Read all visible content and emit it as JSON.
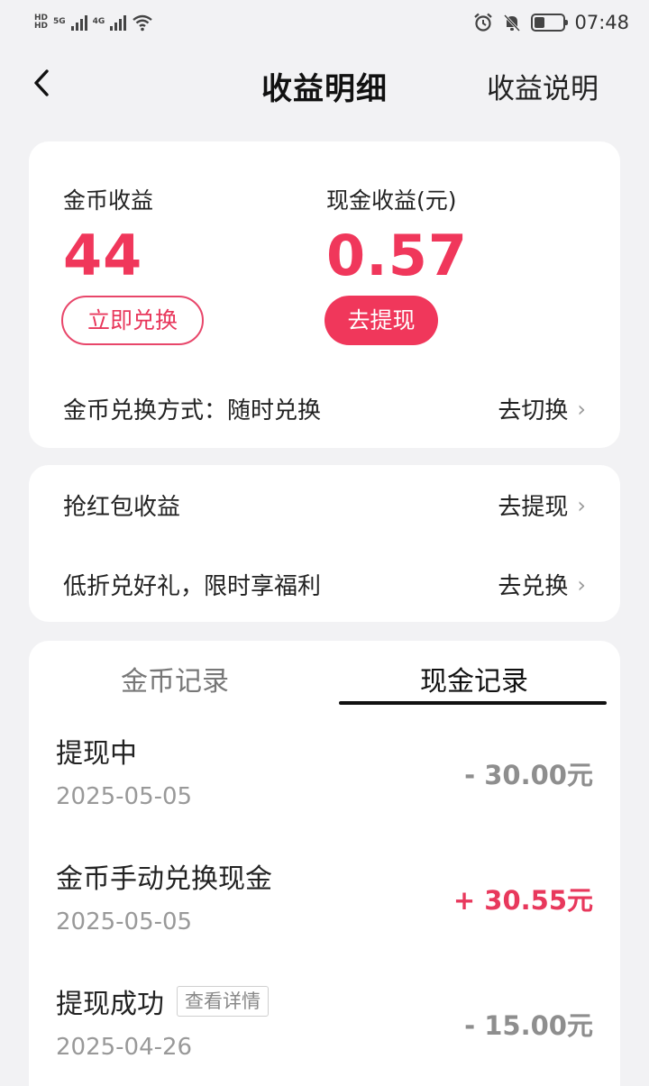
{
  "status_bar": {
    "sim1": "5G",
    "sim2": "4G",
    "time": "07:48"
  },
  "nav": {
    "title": "收益明细",
    "right_link": "收益说明"
  },
  "earnings": {
    "coin_label": "金币收益",
    "coin_value": "44",
    "cash_label": "现金收益(元)",
    "cash_value": "0.57",
    "exchange_button": "立即兑换",
    "withdraw_button": "去提现",
    "method_label": "金币兑换方式：随时兑换",
    "method_action": "去切换"
  },
  "promo": {
    "items": [
      {
        "label": "抢红包收益",
        "action": "去提现"
      },
      {
        "label": "低折兑好礼，限时享福利",
        "action": "去兑换"
      }
    ]
  },
  "records": {
    "tabs": [
      {
        "label": "金币记录",
        "active": false
      },
      {
        "label": "现金记录",
        "active": true
      }
    ],
    "items": [
      {
        "title": "提现中",
        "date": "2025-05-05",
        "amount": "- 30.00元",
        "tag": ""
      },
      {
        "title": "金币手动兑换现金",
        "date": "2025-05-05",
        "amount": "+ 30.55元",
        "tag": ""
      },
      {
        "title": "提现成功",
        "date": "2025-04-26",
        "amount": "- 15.00元",
        "tag": "查看详情"
      }
    ]
  },
  "colors": {
    "accent": "#f0375b",
    "background": "#f2f2f4",
    "card": "#ffffff",
    "muted_amount": "#8e8e8e"
  }
}
